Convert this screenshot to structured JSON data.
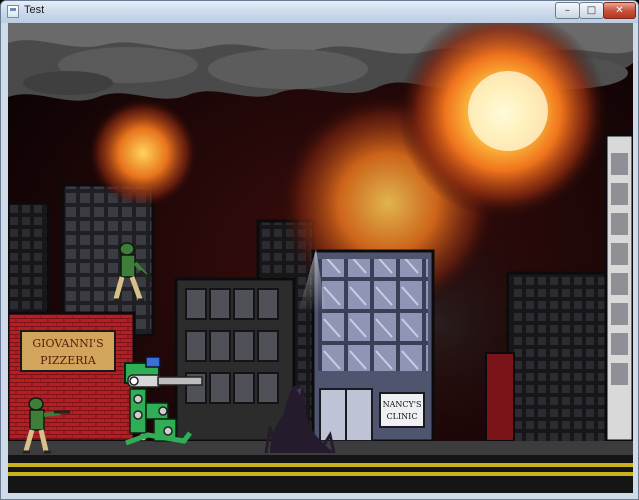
{
  "window": {
    "title": "Test",
    "buttons": {
      "minimize": "–",
      "maximize": "□",
      "close": "✕"
    }
  },
  "scene": {
    "pizzeria_sign": [
      "GIOVANNI'S",
      "PIZZERIA"
    ],
    "clinic_sign": [
      "NANCY'S",
      "CLINIC"
    ]
  },
  "colors": {
    "sky_dark": "#120407",
    "brick": "#b41e24",
    "road_stripe": "#c9b11e",
    "sign_bg": "#d2a55c",
    "soldier_green": "#3f7d3a",
    "mech_green": "#2fae55"
  }
}
